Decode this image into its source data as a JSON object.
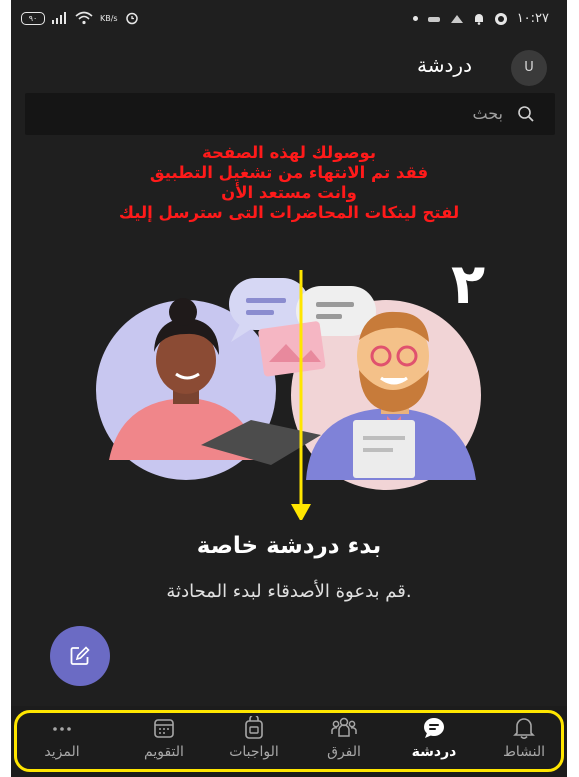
{
  "status_bar": {
    "time": "١٠:٢٧",
    "battery_level": "٩٠",
    "net_speed": "KB/s"
  },
  "header": {
    "title": "دردشة",
    "avatar_initial": "U"
  },
  "search": {
    "placeholder": "بحث"
  },
  "annotation": {
    "line1": "بوصولك لهذه الصفحة",
    "line2": "فقد تم الانتهاء من تشغيل التطبيق",
    "line3": "وانت مستعد الأن",
    "line4": "لفتح لينكات المحاضرات التى سترسل إليك",
    "step_number": "٢",
    "text_color": "#ff1a1a",
    "highlight_color": "#ffe600"
  },
  "empty_state": {
    "title": "بدء دردشة خاصة",
    "description": "قم بدعوة الأصدقاء لبدء المحادثة."
  },
  "fab": {
    "icon": "compose-icon",
    "color": "#6b6bc4"
  },
  "nav": {
    "items": [
      {
        "label": "النشاط",
        "icon": "bell-icon"
      },
      {
        "label": "دردشة",
        "icon": "chat-icon",
        "active": true
      },
      {
        "label": "الفرق",
        "icon": "teams-icon"
      },
      {
        "label": "الواجبات",
        "icon": "assignments-icon"
      },
      {
        "label": "التقويم",
        "icon": "calendar-icon"
      },
      {
        "label": "المزيد",
        "icon": "more-icon"
      }
    ]
  }
}
